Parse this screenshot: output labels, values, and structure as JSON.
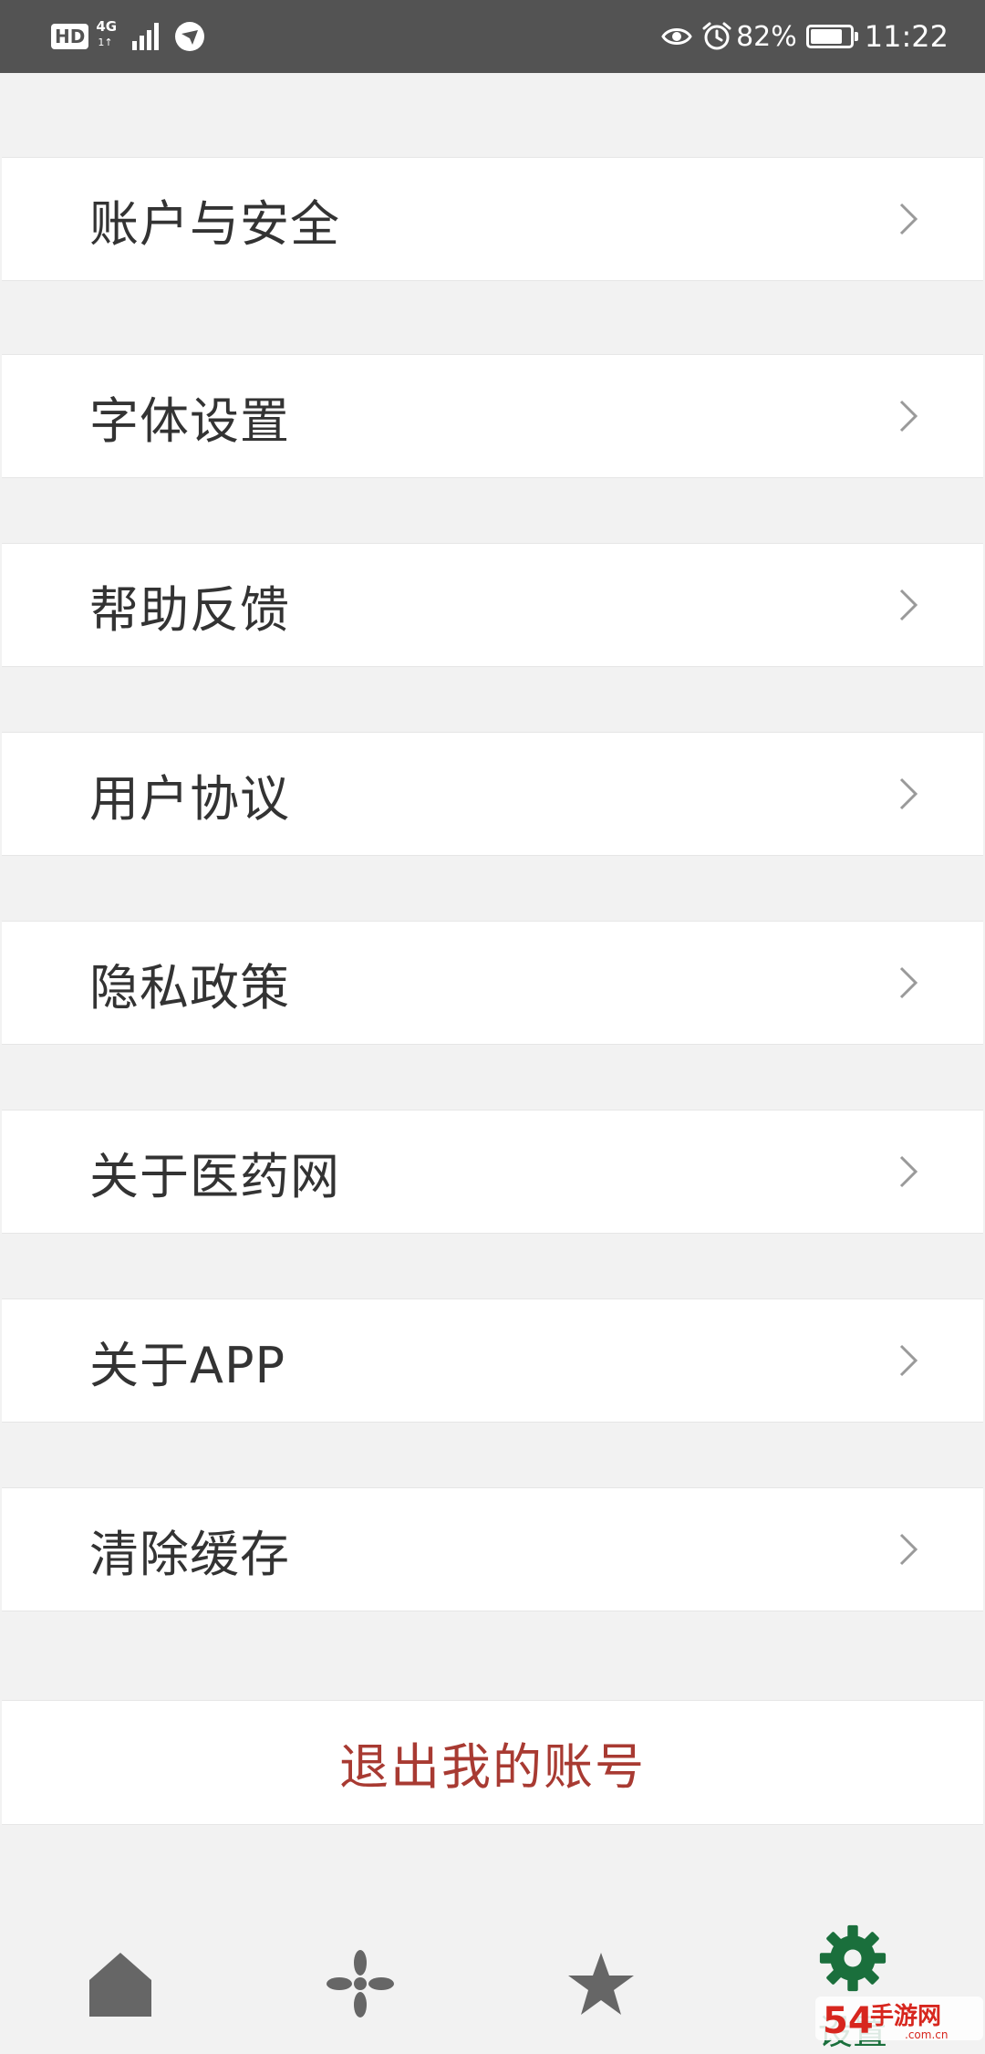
{
  "status_bar": {
    "hd_badge": "HD",
    "network_type": "4G",
    "network_sub": "1↑",
    "battery_percent": 0.82,
    "battery_text": "82%",
    "time": "11:22",
    "icons": [
      "hd-icon",
      "signal-icon",
      "app-notification-icon",
      "eye-icon",
      "alarm-icon",
      "battery-icon"
    ]
  },
  "menu": {
    "items": [
      {
        "label": "账户与安全",
        "icon": "chevron-right-icon"
      },
      {
        "label": "字体设置",
        "icon": "chevron-right-icon"
      },
      {
        "label": "帮助反馈",
        "icon": "chevron-right-icon"
      },
      {
        "label": "用户协议",
        "icon": "chevron-right-icon"
      },
      {
        "label": "隐私政策",
        "icon": "chevron-right-icon"
      },
      {
        "label": "关于医药网",
        "icon": "chevron-right-icon"
      },
      {
        "label": "关于APP",
        "icon": "chevron-right-icon"
      },
      {
        "label": "清除缓存",
        "icon": "chevron-right-icon"
      }
    ],
    "logout_label": "退出我的账号"
  },
  "bottom_nav": {
    "tabs": [
      {
        "name": "home",
        "icon": "home-icon",
        "label": ""
      },
      {
        "name": "discover",
        "icon": "pinwheel-icon",
        "label": ""
      },
      {
        "name": "favorites",
        "icon": "star-icon",
        "label": ""
      },
      {
        "name": "settings",
        "icon": "gear-icon",
        "label": "设置",
        "active": true
      }
    ]
  },
  "watermark": {
    "text": "54手游网",
    "sub": ".com.cn"
  },
  "colors": {
    "status_bar_bg": "#535353",
    "page_bg": "#f2f2f2",
    "item_bg": "#ffffff",
    "text_primary": "#333333",
    "chevron": "#9a9a9a",
    "logout_text": "#a83a32",
    "nav_icon_inactive": "#666666",
    "nav_icon_active": "#1a6f3c",
    "watermark_red": "#d7261e"
  }
}
